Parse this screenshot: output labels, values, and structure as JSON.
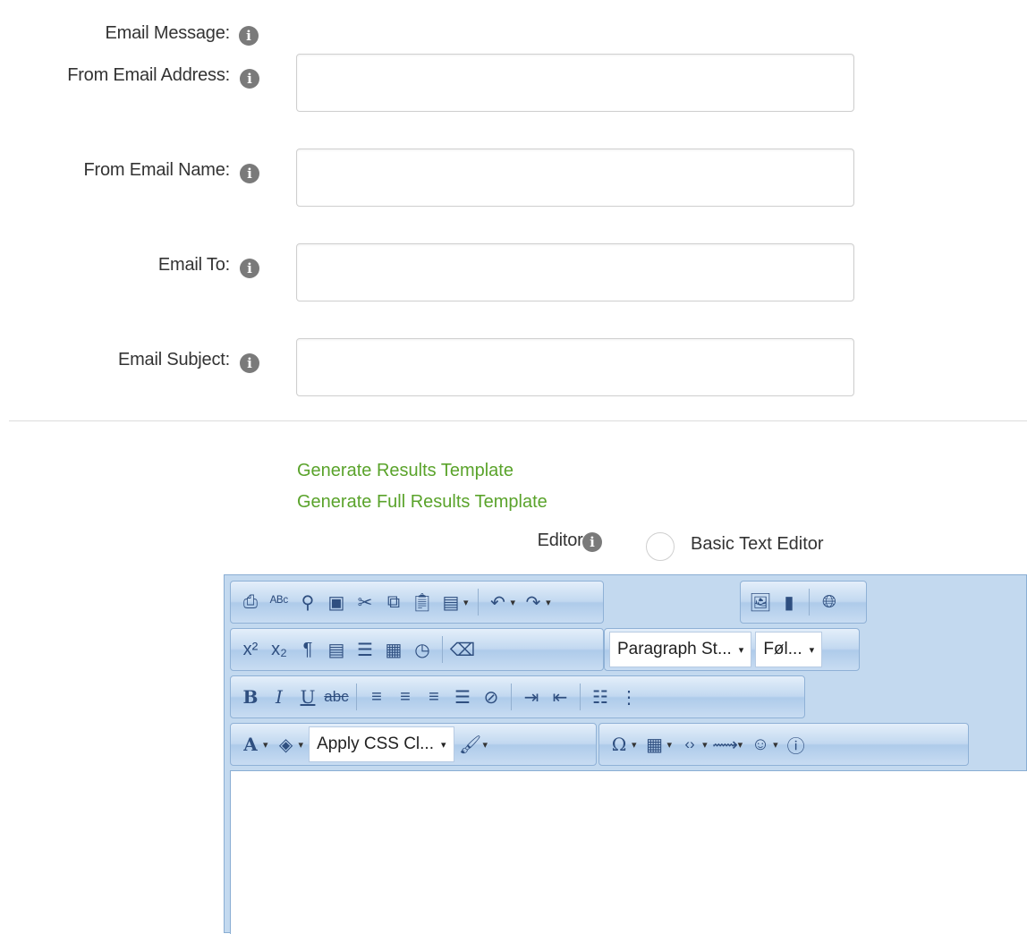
{
  "form": {
    "email_message_label": "Email Message:",
    "from_address_label": "From Email Address:",
    "from_name_label": "From Email Name:",
    "email_to_label": "Email To:",
    "email_subject_label": "Email Subject:",
    "from_address_value": "",
    "from_name_value": "",
    "email_to_value": "",
    "email_subject_value": "",
    "info_glyph": "i"
  },
  "links": {
    "results_template": "Generate Results Template",
    "full_results_template": "Generate Full Results Template"
  },
  "editor": {
    "label": "Editor:",
    "basic_text_editor_label": "Basic Text Editor",
    "paragraph_style": "Paragraph St...",
    "font_size": "Føl...",
    "css_class": "Apply CSS Cl...",
    "content": ""
  },
  "colors": {
    "link_green": "#5aa32b",
    "toolbar_blue": "#c3d9ef",
    "info_grey": "#7a7a7a"
  },
  "icons": [
    "info-icon",
    "print-icon",
    "spellcheck-icon",
    "find-icon",
    "select-all-icon",
    "cut-icon",
    "copy-icon",
    "paste-icon",
    "paste-plain-icon",
    "paste-options-icon",
    "undo-icon",
    "redo-icon",
    "image-manager-icon",
    "document-manager-icon",
    "hyperlink-icon",
    "superscript-icon",
    "subscript-icon",
    "insert-paragraph-icon",
    "new-paragraph-icon",
    "align-left-icon",
    "insert-date-icon",
    "insert-time-icon",
    "format-stripper-icon",
    "bold-icon",
    "italic-icon",
    "underline-icon",
    "strikethrough-icon",
    "justify-left-icon",
    "justify-center-icon",
    "justify-right-icon",
    "justify-full-icon",
    "remove-alignment-icon",
    "indent-icon",
    "outdent-icon",
    "numbered-list-icon",
    "more-icon",
    "font-color-icon",
    "highlight-color-icon",
    "format-painter-icon",
    "special-characters-icon",
    "insert-table-icon",
    "insert-snippet-icon",
    "custom-link-icon",
    "insert-symbol-icon",
    "help-icon"
  ]
}
